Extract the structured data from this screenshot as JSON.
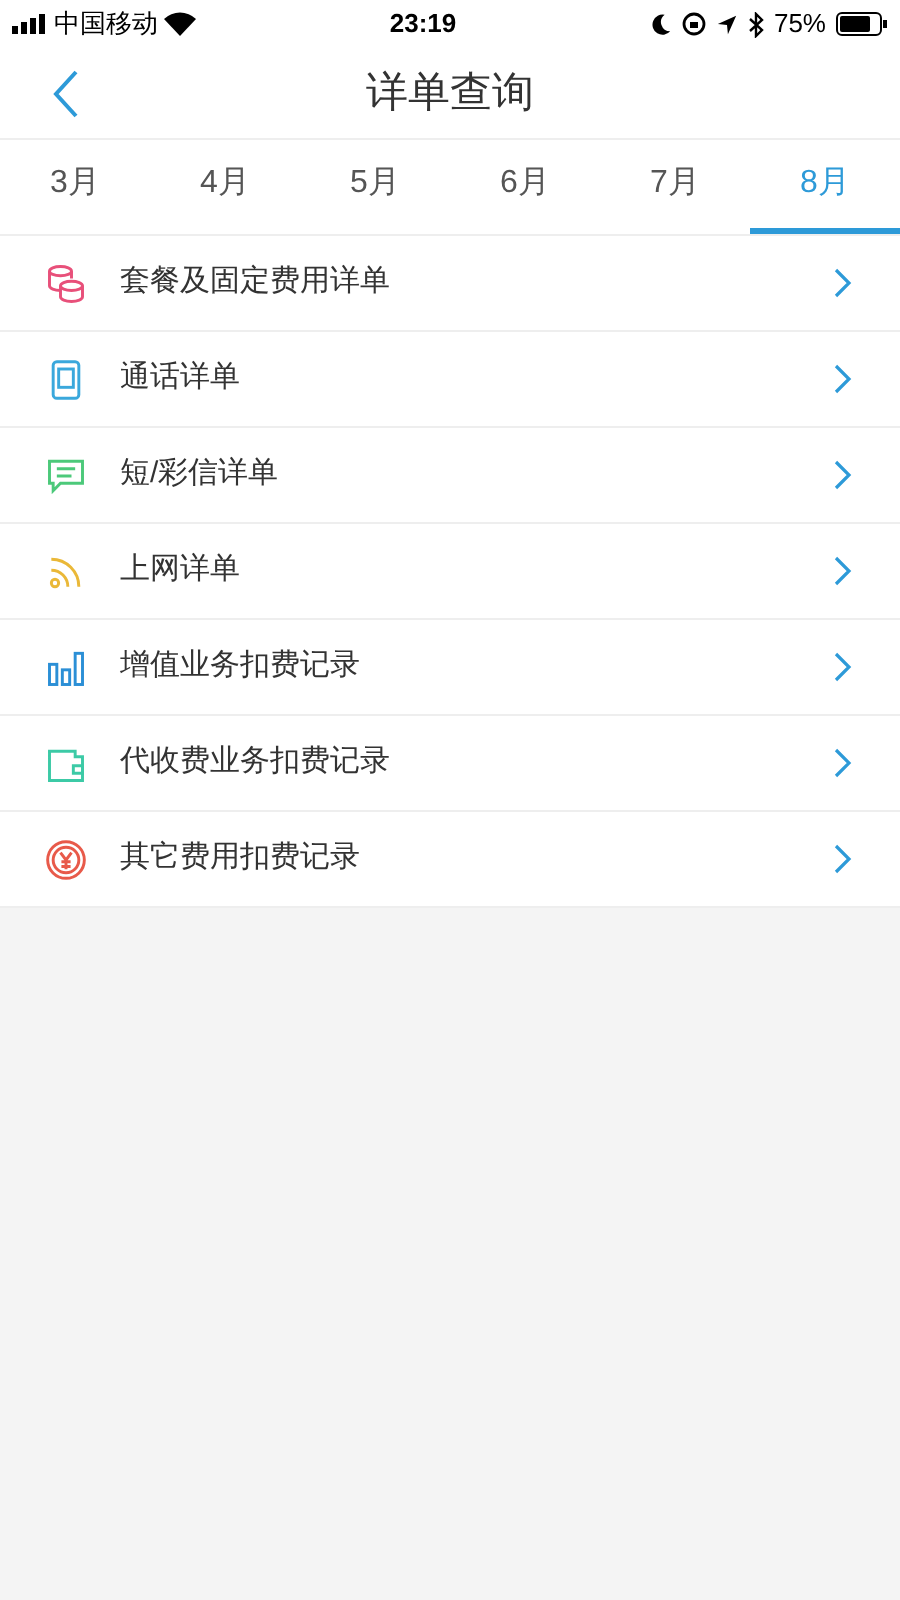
{
  "status_bar": {
    "carrier": "中国移动",
    "time": "23:19",
    "battery": "75%"
  },
  "nav": {
    "title": "详单查询"
  },
  "tabs": [
    {
      "label": "3月",
      "selected": false
    },
    {
      "label": "4月",
      "selected": false
    },
    {
      "label": "5月",
      "selected": false
    },
    {
      "label": "6月",
      "selected": false
    },
    {
      "label": "7月",
      "selected": false
    },
    {
      "label": "8月",
      "selected": true
    }
  ],
  "items": [
    {
      "label": "套餐及固定费用详单",
      "kind": "coins",
      "color": "#e8507a"
    },
    {
      "label": "通话详单",
      "kind": "phone",
      "color": "#3aa8dc"
    },
    {
      "label": "短/彩信详单",
      "kind": "message",
      "color": "#4cc97a"
    },
    {
      "label": "上网详单",
      "kind": "signal",
      "color": "#eab838"
    },
    {
      "label": "增值业务扣费记录",
      "kind": "bars",
      "color": "#2b8fd6"
    },
    {
      "label": "代收费业务扣费记录",
      "kind": "wallet",
      "color": "#3ccaa6"
    },
    {
      "label": "其它费用扣费记录",
      "kind": "yen",
      "color": "#e85a4a"
    }
  ]
}
